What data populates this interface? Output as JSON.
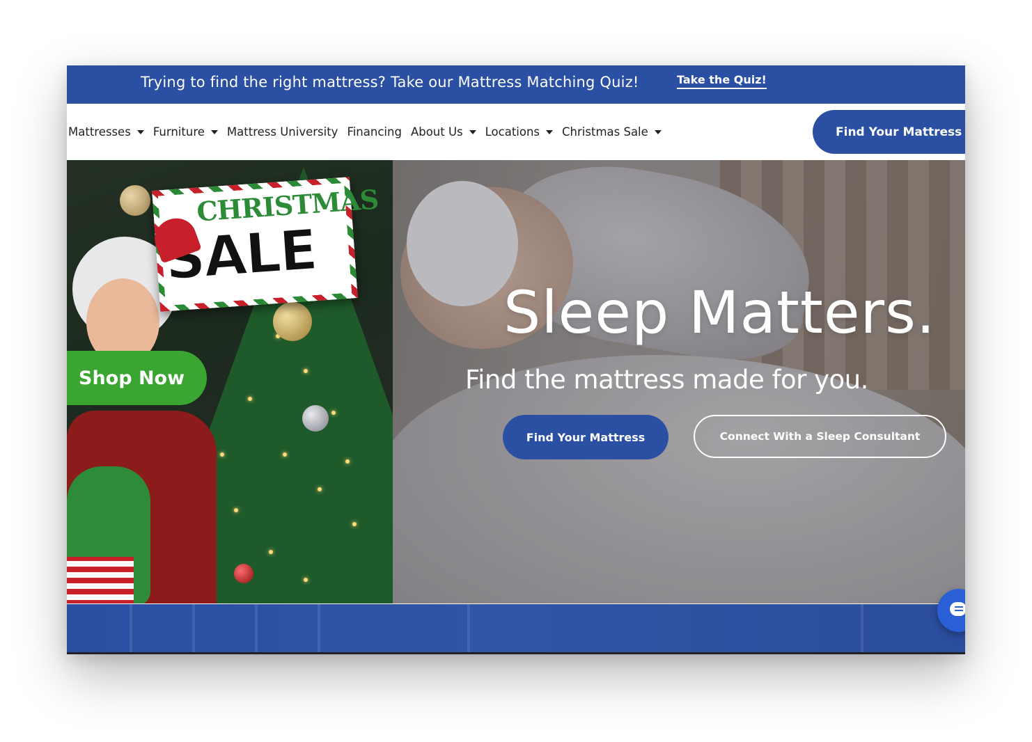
{
  "promo_bar": {
    "text": "Trying to find the right mattress? Take our Mattress Matching Quiz!",
    "link_label": "Take the Quiz!"
  },
  "nav": {
    "items": [
      {
        "label": "Mattresses",
        "dropdown": true
      },
      {
        "label": "Furniture",
        "dropdown": true
      },
      {
        "label": "Mattress University",
        "dropdown": false
      },
      {
        "label": "Financing",
        "dropdown": false
      },
      {
        "label": "About Us",
        "dropdown": true
      },
      {
        "label": "Locations",
        "dropdown": true
      },
      {
        "label": "Christmas Sale",
        "dropdown": true
      }
    ],
    "cta_label": "Find Your Mattress"
  },
  "promo_panel": {
    "sign_line1": "CHRISTMAS",
    "sign_line2": "SALE",
    "button_label": "Shop Now"
  },
  "hero": {
    "title": "Sleep Matters.",
    "subtitle": "Find the mattress made for you.",
    "primary_cta": "Find Your Mattress",
    "secondary_cta": "Connect With a Sleep Consultant"
  },
  "chat": {
    "icon": "chat-bubble-icon"
  },
  "colors": {
    "brand_blue": "#2a4fa3",
    "shop_green": "#3aa631",
    "chat_blue": "#2a5fd6"
  }
}
